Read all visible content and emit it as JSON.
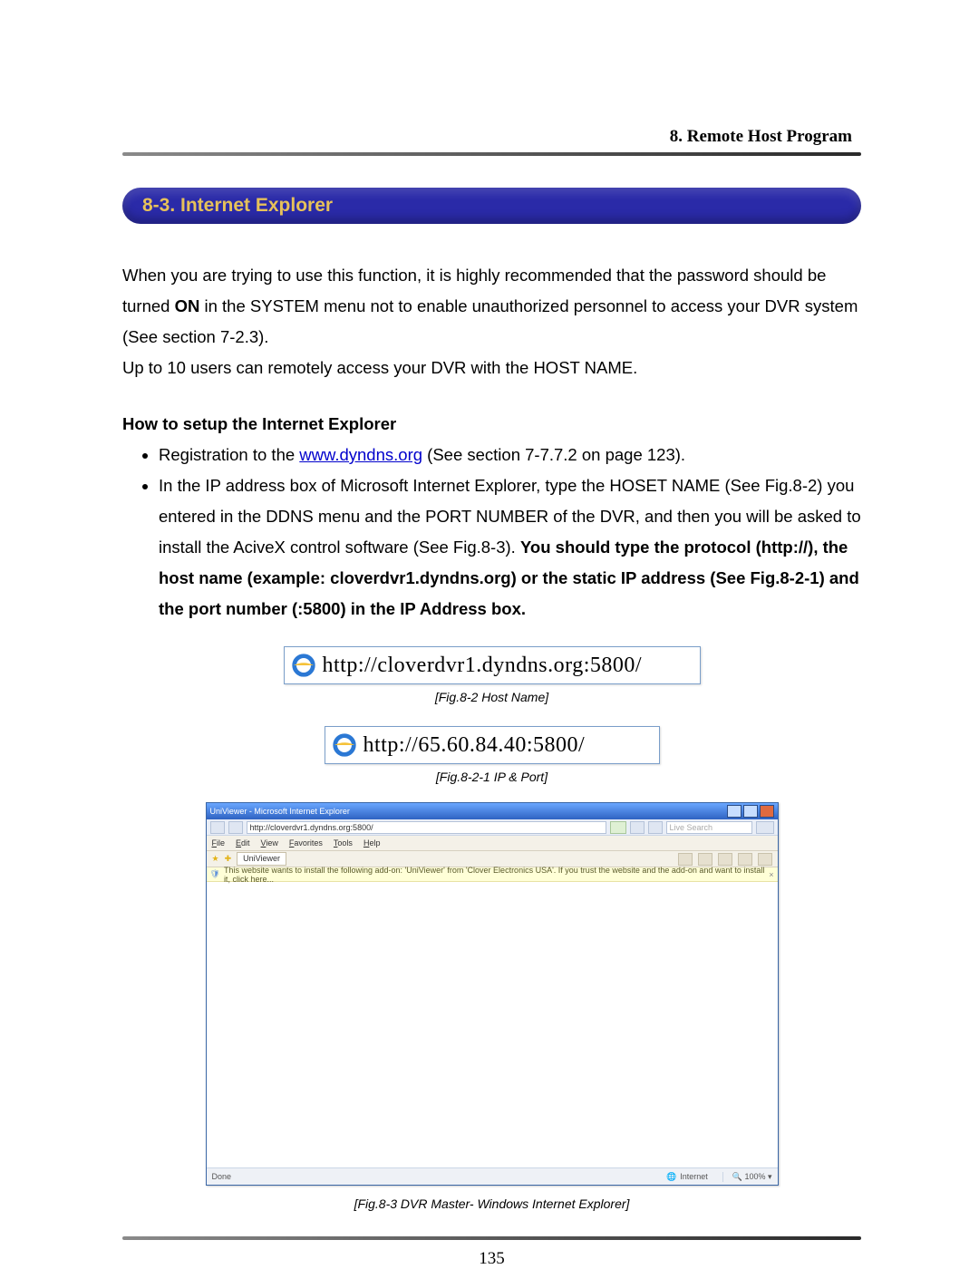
{
  "header": {
    "chapter": "8. Remote Host Program"
  },
  "section": {
    "title": "8-3. Internet Explorer"
  },
  "intro": {
    "p1a": "When you are trying to use this function, it is highly recommended that the password should be turned ",
    "on": "ON",
    "p1b": " in the SYSTEM menu not to enable unauthorized personnel to access your DVR system (See section 7-2.3).",
    "p2": "Up to 10 users can remotely access your DVR with the HOST NAME."
  },
  "howto": {
    "heading": "How to setup the Internet Explorer",
    "b1a": "Registration to the ",
    "b1_link": "www.dyndns.org",
    "b1b": " (See section 7-7.7.2 on page 123).",
    "b2a": "In the IP address box of Microsoft Internet Explorer, type the HOSET NAME (See Fig.8-2) you entered in the DDNS menu and the PORT NUMBER of the DVR, and then you will be asked to install the AciveX control software (See Fig.8-3). ",
    "b2_bold": "You should type the protocol (http://), the host name (example: cloverdvr1.dyndns.org) or the static IP address (See Fig.8-2-1) and the port number (:5800) in the IP Address box."
  },
  "addr1": {
    "url": "http://cloverdvr1.dyndns.org:5800/"
  },
  "cap1": "[Fig.8-2 Host Name]",
  "addr2": {
    "url": "http://65.60.84.40:5800/"
  },
  "cap2": "[Fig.8-2-1 IP & Port]",
  "ie": {
    "title": "UniViewer - Microsoft Internet Explorer",
    "url": "http://cloverdvr1.dyndns.org:5800/",
    "search_placeholder": "Live Search",
    "menu": {
      "file": "File",
      "edit": "Edit",
      "view": "View",
      "favorites": "Favorites",
      "tools": "Tools",
      "help": "Help"
    },
    "tab": "UniViewer",
    "infobar": "This website wants to install the following add-on: 'UniViewer' from 'Clover Electronics USA'. If you trust the website and the add-on and want to install it, click here...",
    "status_done": "Done",
    "status_zone": "Internet",
    "status_zoom": "100%"
  },
  "cap3": "[Fig.8-3 DVR Master- Windows Internet Explorer]",
  "page_number": "135"
}
